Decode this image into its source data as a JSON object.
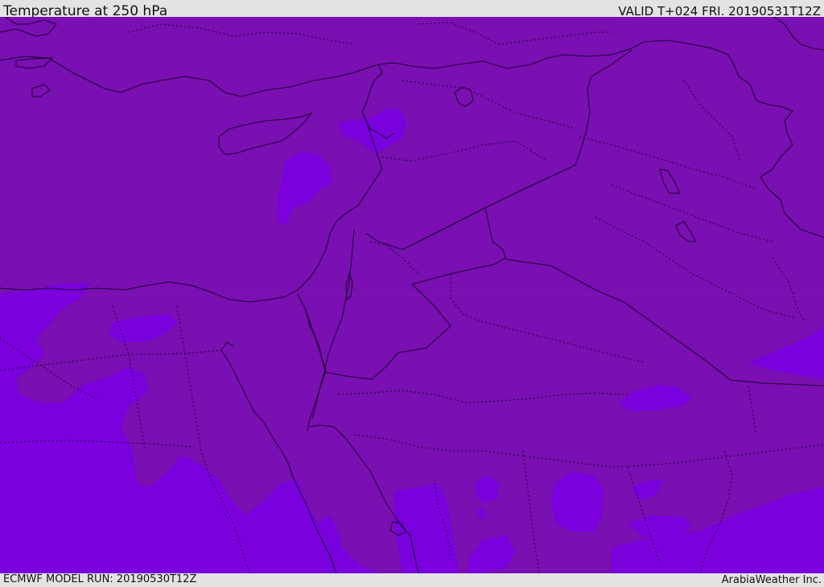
{
  "header": {
    "title": "Temperature at 250 hPa",
    "valid": "VALID T+024 FRI. 20190531T12Z"
  },
  "footer": {
    "model_run": "ECMWF MODEL RUN: 20190530T12Z",
    "credit": "ArabiaWeather Inc."
  },
  "map": {
    "field": "temperature-250hPa",
    "colors": {
      "warmer": "#7a0fb2",
      "colder": "#7a00de",
      "border": "#1a0030"
    }
  }
}
